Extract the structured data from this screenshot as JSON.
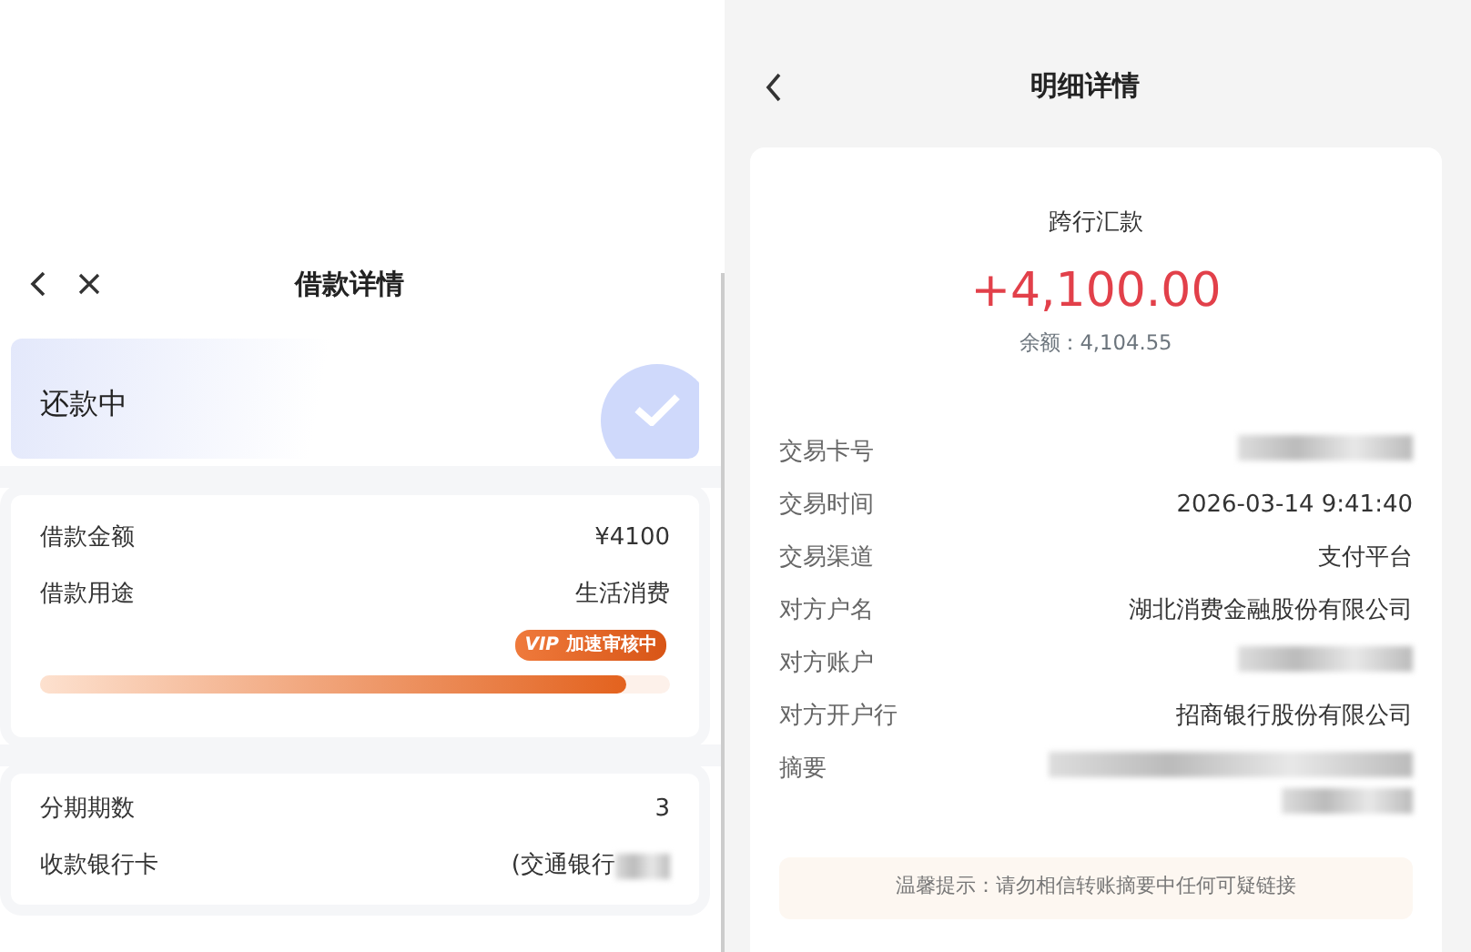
{
  "loan_screen": {
    "title": "借款详情",
    "status": "还款中",
    "details": [
      {
        "label": "借款金额",
        "value": "¥4100"
      },
      {
        "label": "借款用途",
        "value": "生活消费"
      }
    ],
    "progress": {
      "badge_vip": "VIP",
      "badge_text": "加速审核中",
      "level": 0.93
    },
    "installments": [
      {
        "label": "分期期数",
        "value": "3"
      },
      {
        "label": "收款银行卡",
        "value": "(交通银行",
        "redacted": true
      }
    ]
  },
  "transfer_screen": {
    "title": "明细详情",
    "transaction_type": "跨行汇款",
    "amount": "+4,100.00",
    "balance": "余额：4,104.55",
    "rows": [
      {
        "label": "交易卡号",
        "redacted": true
      },
      {
        "label": "交易时间",
        "value": "2026-03-14 9:41:40"
      },
      {
        "label": "交易渠道",
        "value": "支付平台"
      },
      {
        "label": "对方户名",
        "value": "湖北消费金融股份有限公司"
      },
      {
        "label": "对方账户",
        "redacted": true
      },
      {
        "label": "对方开户行",
        "value": "招商银行股份有限公司"
      },
      {
        "label": "摘要",
        "redacted": true,
        "multiline": true
      }
    ],
    "notice": "温馨提示：请勿相信转账摘要中任何可疑链接"
  }
}
